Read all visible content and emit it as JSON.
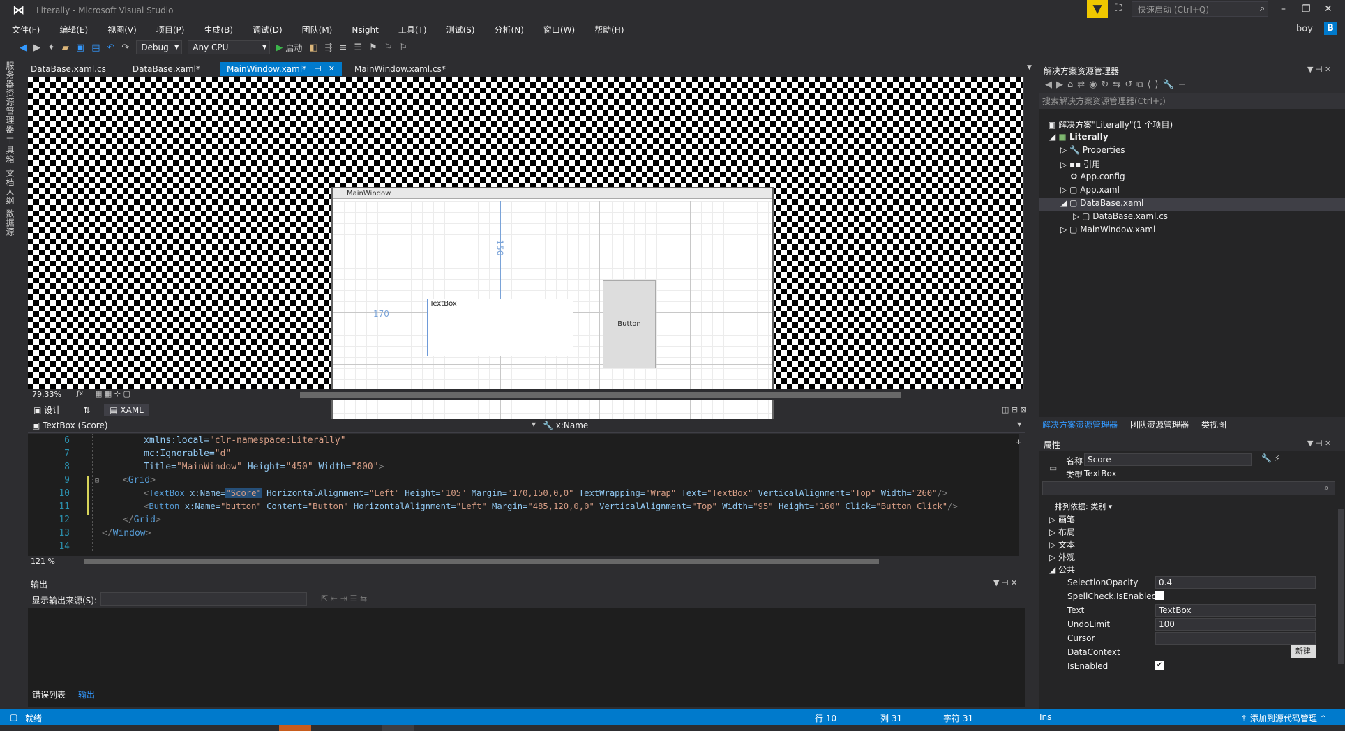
{
  "window": {
    "title": "Literally - Microsoft Visual Studio",
    "logo": "VS"
  },
  "quick_launch": {
    "placeholder": "快速启动 (Ctrl+Q)"
  },
  "user": {
    "name": "boy",
    "initial": "B"
  },
  "menu": [
    "文件(F)",
    "编辑(E)",
    "视图(V)",
    "项目(P)",
    "生成(B)",
    "调试(D)",
    "团队(M)",
    "Nsight",
    "工具(T)",
    "测试(S)",
    "分析(N)",
    "窗口(W)",
    "帮助(H)"
  ],
  "toolbar": {
    "config": "Debug",
    "platform": "Any CPU",
    "start_label": "启动"
  },
  "left_strip": [
    "服务器资源管理器",
    "工具箱",
    "文档大纲",
    "数据源"
  ],
  "doc_tabs": [
    {
      "label": "DataBase.xaml.cs",
      "active": false
    },
    {
      "label": "DataBase.xaml*",
      "active": false
    },
    {
      "label": "MainWindow.xaml*",
      "active": true
    },
    {
      "label": "MainWindow.xaml.cs*",
      "active": false
    }
  ],
  "designer": {
    "window_title": "MainWindow",
    "textbox_label": "TextBox",
    "button_label": "Button",
    "margin_top": "150",
    "margin_left": "170",
    "zoom": "79.33%"
  },
  "split_tabs": {
    "design": "设计",
    "swap": "⇅",
    "xaml": "XAML"
  },
  "path_bar": {
    "element": "TextBox (Score)",
    "property": "x:Name"
  },
  "code_lines": [
    {
      "n": "6",
      "text": "xmlns:local=\"clr-namespace:Literally\""
    },
    {
      "n": "7",
      "text": "mc:Ignorable=\"d\""
    },
    {
      "n": "8",
      "text": "Title=\"MainWindow\" Height=\"450\" Width=\"800\">"
    },
    {
      "n": "9",
      "text": "<Grid>"
    },
    {
      "n": "10",
      "text": "<TextBox x:Name=\"Score\" HorizontalAlignment=\"Left\" Height=\"105\" Margin=\"170,150,0,0\" TextWrapping=\"Wrap\" Text=\"TextBox\" VerticalAlignment=\"Top\" Width=\"260\"/>"
    },
    {
      "n": "11",
      "text": "<Button x:Name=\"button\" Content=\"Button\" HorizontalAlignment=\"Left\" Margin=\"485,120,0,0\" VerticalAlignment=\"Top\" Width=\"95\" Height=\"160\" Click=\"Button_Click\"/>"
    },
    {
      "n": "12",
      "text": "</Grid>"
    },
    {
      "n": "13",
      "text": "</Window>"
    },
    {
      "n": "14",
      "text": ""
    }
  ],
  "editor_zoom": "121 %",
  "output": {
    "title": "输出",
    "source_label": "显示输出来源(S):",
    "tabs": [
      "错误列表",
      "输出"
    ]
  },
  "solution_explorer": {
    "title": "解决方案资源管理器",
    "search_placeholder": "搜索解决方案资源管理器(Ctrl+;)",
    "items": [
      {
        "label": "解决方案\"Literally\"(1 个项目)",
        "indent": 0
      },
      {
        "label": "Literally",
        "indent": 1
      },
      {
        "label": "Properties",
        "indent": 2
      },
      {
        "label": "引用",
        "indent": 2
      },
      {
        "label": "App.config",
        "indent": 2
      },
      {
        "label": "App.xaml",
        "indent": 2
      },
      {
        "label": "DataBase.xaml",
        "indent": 2
      },
      {
        "label": "DataBase.xaml.cs",
        "indent": 3
      },
      {
        "label": "MainWindow.xaml",
        "indent": 2
      }
    ],
    "bottom_tabs": [
      "解决方案资源管理器",
      "团队资源管理器",
      "类视图"
    ]
  },
  "properties": {
    "title": "属性",
    "name_label": "名称",
    "name_value": "Score",
    "type_label": "类型",
    "type_value": "TextBox",
    "sort_label": "排列依据: 类别",
    "categories": [
      "画笔",
      "布局",
      "文本",
      "外观",
      "公共"
    ],
    "rows": [
      {
        "name": "SelectionOpacity",
        "value": "0.4"
      },
      {
        "name": "SpellCheck.IsEnabled",
        "value": ""
      },
      {
        "name": "Text",
        "value": "TextBox"
      },
      {
        "name": "UndoLimit",
        "value": "100"
      },
      {
        "name": "Cursor",
        "value": ""
      },
      {
        "name": "DataContext",
        "value": ""
      },
      {
        "name": "IsEnabled",
        "value": ""
      }
    ],
    "new_button": "新建"
  },
  "status": {
    "ready": "就绪",
    "line": "行 10",
    "col": "列 31",
    "char": "字符 31",
    "ins": "Ins",
    "source_control": "添加到源代码管理"
  },
  "colors": {
    "accent": "#007acc",
    "background": "#2d2d30",
    "editor": "#1e1e1e"
  }
}
